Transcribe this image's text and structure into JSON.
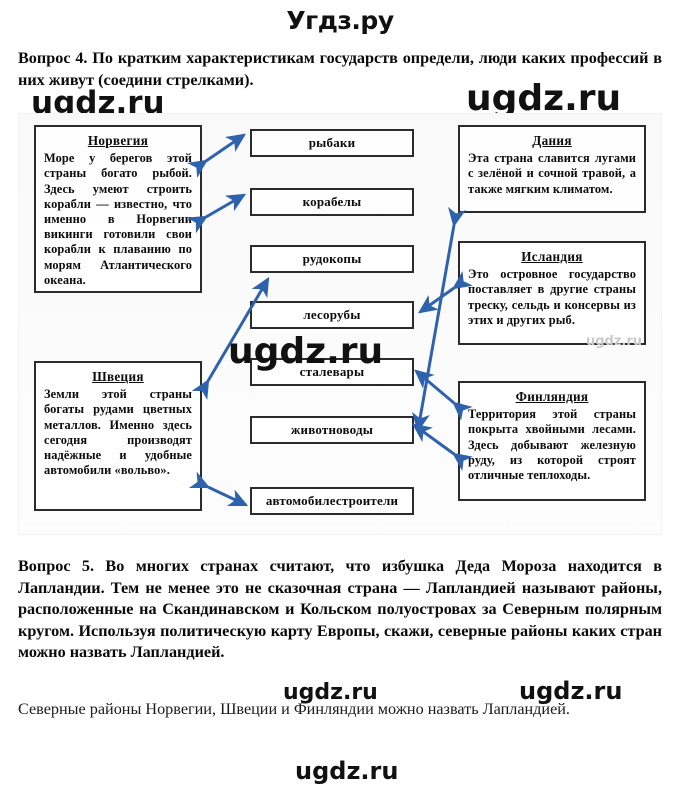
{
  "site": {
    "title": "Угдз.ру",
    "watermark": "ugdz.ru"
  },
  "question4": {
    "label": "Вопрос 4.",
    "text": "Вопрос 4. По кратким характеристикам государств определи, люди каких профессий в них живут (соедини стрелками)."
  },
  "question5": {
    "label": "Вопрос 5.",
    "text": "Вопрос 5. Во многих странах считают, что избушка Деда Мороза находится в Лапландии. Тем не менее это не сказочная страна — Лапландией называют районы, расположенные на Скандинавском и Кольском полуостровах за Северным полярным кругом. Используя политическую карту Европы, скажи, северные районы каких стран можно назвать Лапландией.",
    "answer": "Северные районы Норвегии, Швеции и Финляндии можно назвать Лапландией."
  },
  "diagram": {
    "countries": [
      {
        "id": "norvegiya",
        "title": "Норвегия",
        "body": "Море у берегов этой страны богато рыбой. Здесь умеют строить корабли — известно, что именно в Норвегии викинги готовили свои корабли к плаванию по морям Атлантического океана."
      },
      {
        "id": "shveciya",
        "title": "Швеция",
        "body": "Земли этой страны богаты рудами цветных металлов. Именно здесь сегодня производят надёжные и удобные автомобили «вольво»."
      },
      {
        "id": "daniya",
        "title": "Дания",
        "body": "Эта страна славится лугами с зелёной и сочной травой, а также мягким климатом."
      },
      {
        "id": "islandiya",
        "title": "Исландия",
        "body": "Это островное государство поставляет в другие страны треску, сельдь и консервы из этих и других рыб."
      },
      {
        "id": "finlyandiya",
        "title": "Финляндия",
        "body": "Территория этой страны покрыта хвойными лесами. Здесь добывают железную руду, из которой строят отличные теплоходы."
      }
    ],
    "professions": [
      {
        "id": "rybaki",
        "label": "рыбаки"
      },
      {
        "id": "korabely",
        "label": "корабелы"
      },
      {
        "id": "rudokopy",
        "label": "рудокопы"
      },
      {
        "id": "lesoruby",
        "label": "лесорубы"
      },
      {
        "id": "stalevary",
        "label": "сталевары"
      },
      {
        "id": "zhivotnovody",
        "label": "животноводы"
      },
      {
        "id": "avtomobilestroiteli",
        "label": "автомобилестроители"
      }
    ],
    "connections": [
      {
        "from": "norvegiya",
        "to": "rybaki"
      },
      {
        "from": "norvegiya",
        "to": "korabely"
      },
      {
        "from": "shveciya",
        "to": "rudokopy"
      },
      {
        "from": "shveciya",
        "to": "avtomobilestroiteli"
      },
      {
        "from": "daniya",
        "to": "zhivotnovody"
      },
      {
        "from": "islandiya",
        "to": "rybaki"
      },
      {
        "from": "finlyandiya",
        "to": "lesoruby"
      },
      {
        "from": "finlyandiya",
        "to": "stalevary"
      }
    ],
    "arrow_color": "#2f62ad"
  }
}
